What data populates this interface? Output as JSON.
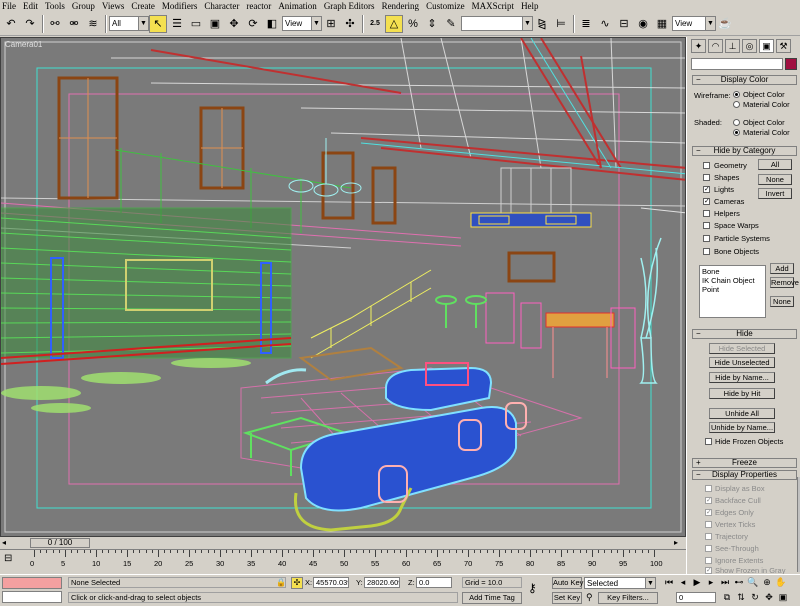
{
  "menu": [
    "File",
    "Edit",
    "Tools",
    "Group",
    "Views",
    "Create",
    "Modifiers",
    "Character",
    "reactor",
    "Animation",
    "Graph Editors",
    "Rendering",
    "Customize",
    "MAXScript",
    "Help"
  ],
  "toolbar": {
    "selection_filter": "All",
    "ref_coord": "View",
    "snap_value": "2.5",
    "named_selection": "",
    "render_view": "View"
  },
  "viewport": {
    "label": "Camera01"
  },
  "panel": {
    "display_color": {
      "title": "Display Color",
      "wireframe_label": "Wireframe:",
      "shaded_label": "Shaded:",
      "object_color": "Object Color",
      "material_color": "Material Color"
    },
    "hide_by_category": {
      "title": "Hide by Category",
      "items": [
        {
          "label": "Geometry",
          "checked": false
        },
        {
          "label": "Shapes",
          "checked": false
        },
        {
          "label": "Lights",
          "checked": true
        },
        {
          "label": "Cameras",
          "checked": true
        },
        {
          "label": "Helpers",
          "checked": false
        },
        {
          "label": "Space Warps",
          "checked": false
        },
        {
          "label": "Particle Systems",
          "checked": false
        },
        {
          "label": "Bone Objects",
          "checked": false
        }
      ],
      "all": "All",
      "none": "None",
      "invert": "Invert",
      "list": [
        "Bone",
        "IK Chain Object",
        "Point"
      ],
      "add": "Add",
      "remove": "Remove",
      "none2": "None"
    },
    "hide": {
      "title": "Hide",
      "hide_selected": "Hide Selected",
      "hide_unselected": "Hide Unselected",
      "hide_by_name": "Hide by Name...",
      "hide_by_hit": "Hide by Hit",
      "unhide_all": "Unhide All",
      "unhide_by_name": "Unhide by Name...",
      "hide_frozen": "Hide Frozen Objects"
    },
    "freeze": {
      "title": "Freeze"
    },
    "display_properties": {
      "title": "Display Properties",
      "items": [
        {
          "label": "Display as Box",
          "checked": false
        },
        {
          "label": "Backface Cull",
          "checked": true
        },
        {
          "label": "Edges Only",
          "checked": true
        },
        {
          "label": "Vertex Ticks",
          "checked": false
        },
        {
          "label": "Trajectory",
          "checked": false
        },
        {
          "label": "See-Through",
          "checked": false
        },
        {
          "label": "Ignore Extents",
          "checked": false
        },
        {
          "label": "Show Frozen in Gray",
          "checked": true
        }
      ]
    }
  },
  "timeline": {
    "frame": "0 / 100",
    "ticks": [
      "0",
      "5",
      "10",
      "15",
      "20",
      "25",
      "30",
      "35",
      "40",
      "45",
      "50",
      "55",
      "60",
      "65",
      "70",
      "75",
      "80",
      "85",
      "90",
      "95",
      "100"
    ]
  },
  "status": {
    "selection": "None Selected",
    "prompt": "Click or click-and-drag to select objects",
    "x_label": "X:",
    "x": "45570.039",
    "y_label": "Y:",
    "y": "28020.609",
    "z_label": "Z:",
    "z": "0.0",
    "grid": "Grid = 10.0",
    "add_time_tag": "Add Time Tag",
    "auto_key": "Auto Key",
    "set_key": "Set Key",
    "key_set": "Selected",
    "key_filters": "Key Filters...",
    "current_frame": "0"
  }
}
